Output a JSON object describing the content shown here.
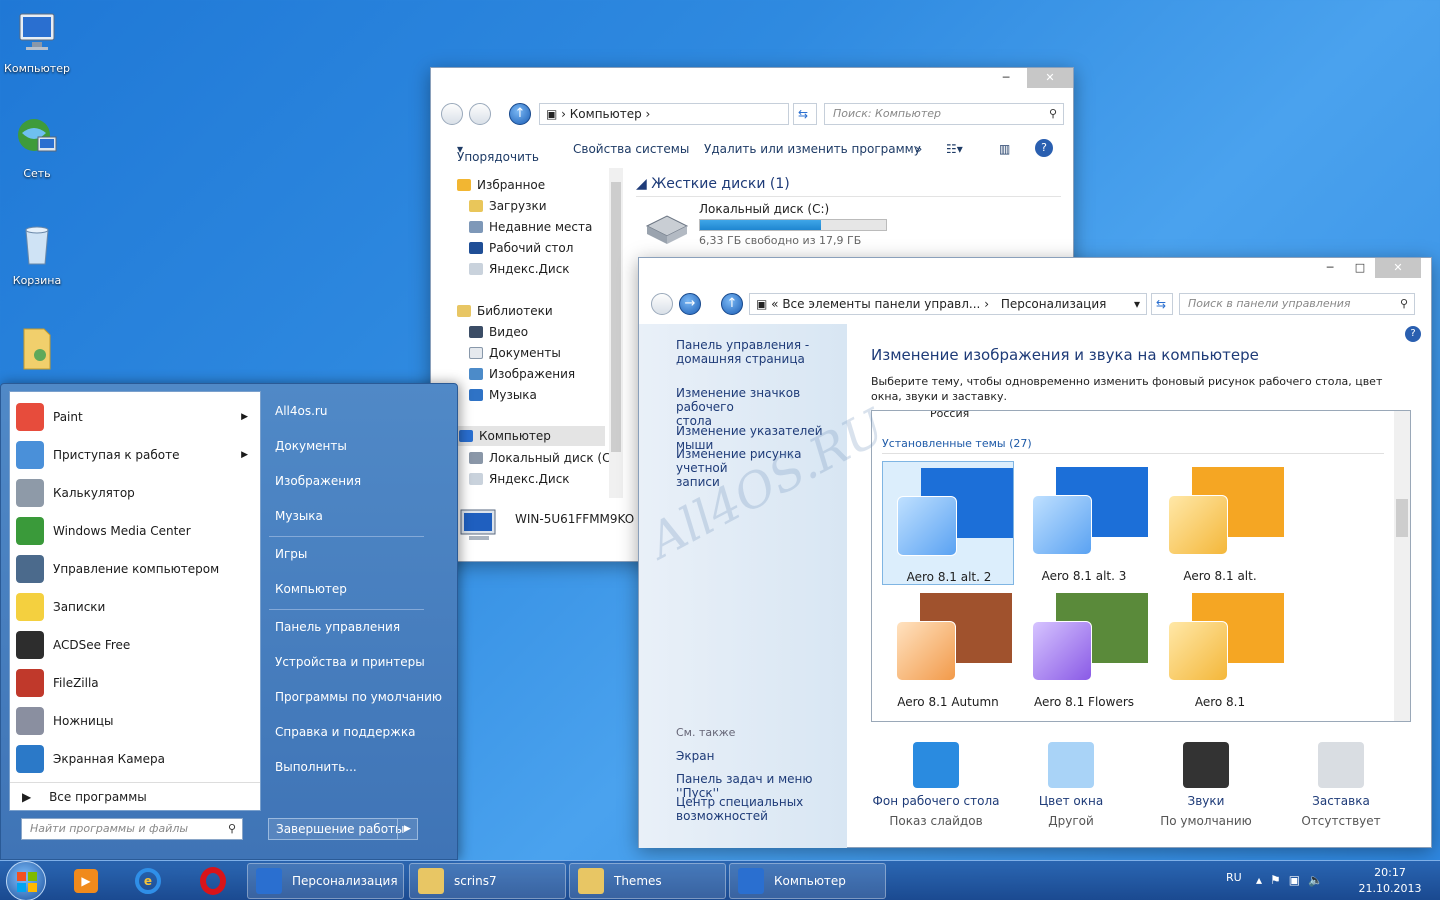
{
  "desktop": {
    "icons": [
      "Компьютер",
      "Сеть",
      "Корзина"
    ]
  },
  "explorer": {
    "address": "Компьютер",
    "search_placeholder": "Поиск: Компьютер",
    "toolbar": {
      "organize": "Упорядочить",
      "sysprops": "Свойства системы",
      "uninstall": "Удалить или изменить программу",
      "more": "»"
    },
    "tree": {
      "favorites": "Избранное",
      "downloads": "Загрузки",
      "recent": "Недавние места",
      "desktop": "Рабочий стол",
      "yadisk": "Яндекс.Диск",
      "libraries": "Библиотеки",
      "video": "Видео",
      "docs": "Документы",
      "images": "Изображения",
      "music": "Музыка",
      "computer": "Компьютер",
      "localdisk": "Локальный диск (C:)",
      "yadisk2": "Яндекс.Диск"
    },
    "section": "Жесткие диски (1)",
    "disk": {
      "name": "Локальный диск (C:)",
      "free": "6,33 ГБ свободно из 17,9 ГБ",
      "used_fraction": 0.65
    },
    "pc_name": "WIN-5U61FFMM9KO"
  },
  "cpanel": {
    "address_part1": "Все элементы панели управл...",
    "address_part2": "Персонализация",
    "search_placeholder": "Поиск в панели управления",
    "side": {
      "home_line1": "Панель управления -",
      "home_line2": "домашняя страница",
      "icons_line1": "Изменение значков рабочего",
      "icons_line2": "стола",
      "pointers": "Изменение указателей мыши",
      "account_line1": "Изменение рисунка учетной",
      "account_line2": "записи",
      "seealso": "См. также",
      "display": "Экран",
      "taskbar": "Панель задач и меню ''Пуск''",
      "access_line1": "Центр специальных",
      "access_line2": "возможностей"
    },
    "heading": "Изменение изображения и звука на компьютере",
    "desc": "Выберите тему, чтобы одновременно изменить фоновый рисунок рабочего стола, цвет окна, звуки и заставку.",
    "russia": "Россия",
    "installed": "Установленные темы (27)",
    "themes": [
      "Aero 8.1 alt. 2",
      "Aero 8.1 alt. 3",
      "Aero 8.1 alt.",
      "Aero 8.1 Autumn",
      "Aero 8.1 Flowers",
      "Aero 8.1"
    ],
    "bottom": [
      {
        "title": "Фон рабочего стола",
        "sub": "Показ слайдов"
      },
      {
        "title": "Цвет окна",
        "sub": "Другой"
      },
      {
        "title": "Звуки",
        "sub": "По умолчанию"
      },
      {
        "title": "Заставка",
        "sub": "Отсутствует"
      }
    ]
  },
  "watermark": "All4OS.RU",
  "start": {
    "left": [
      "Paint",
      "Приступая к работе",
      "Калькулятор",
      "Windows Media Center",
      "Управление компьютером",
      "Записки",
      "ACDSee Free",
      "FileZilla",
      "Ножницы",
      "Экранная Камера"
    ],
    "all": "Все программы",
    "search_placeholder": "Найти программы и файлы",
    "right": [
      "All4os.ru",
      "Документы",
      "Изображения",
      "Музыка",
      "Игры",
      "Компьютер",
      "Панель управления",
      "Устройства и принтеры",
      "Программы по умолчанию",
      "Справка и поддержка",
      "Выполнить..."
    ],
    "shutdown": "Завершение работы"
  },
  "taskbar": {
    "items": [
      "Персонализация",
      "scrins7",
      "Themes",
      "Компьютер"
    ],
    "lang": "RU",
    "time": "20:17",
    "date": "21.10.2013"
  }
}
